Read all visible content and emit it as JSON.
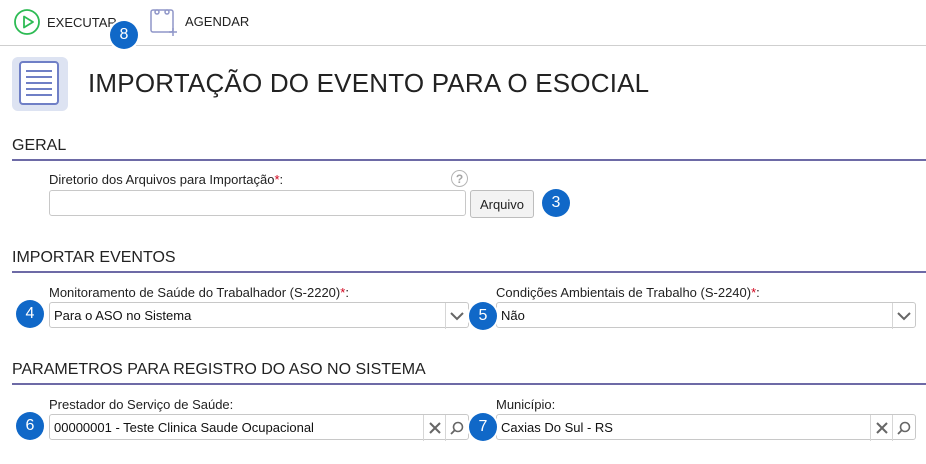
{
  "toolbar": {
    "execute_label": "EXECUTAR",
    "schedule_label": "AGENDAR",
    "execute_badge": "8"
  },
  "page": {
    "title": "IMPORTAÇÃO DO EVENTO PARA O ESOCIAL"
  },
  "sections": {
    "geral": "GERAL",
    "importar": "IMPORTAR EVENTOS",
    "parametros": "PARAMETROS PARA REGISTRO DO ASO NO SISTEMA"
  },
  "geral": {
    "dir_label": "Diretorio dos Arquivos para Importação",
    "dir_value": "",
    "required_mark": "*",
    "colon": ":",
    "help_glyph": "?",
    "file_button": "Arquivo",
    "file_badge": "3"
  },
  "importar": {
    "monitoramento_label": "Monitoramento de Saúde do Trabalhador (S-2220)",
    "monitoramento_value": "Para o ASO no Sistema",
    "monitoramento_badge": "4",
    "condicoes_label": "Condições Ambientais de Trabalho (S-2240)",
    "condicoes_value": "Não",
    "condicoes_badge": "5"
  },
  "parametros": {
    "prestador_label": "Prestador do Serviço de Saúde:",
    "prestador_value": "00000001 - Teste Clinica Saude Ocupacional",
    "prestador_badge": "6",
    "municipio_label": "Município:",
    "municipio_value": "Caxias Do Sul - RS",
    "municipio_badge": "7"
  },
  "colors": {
    "accent_green": "#2dbb54",
    "badge_blue": "#1068c8",
    "section_rule": "#6d6aa6",
    "required_red": "#d0021b"
  }
}
